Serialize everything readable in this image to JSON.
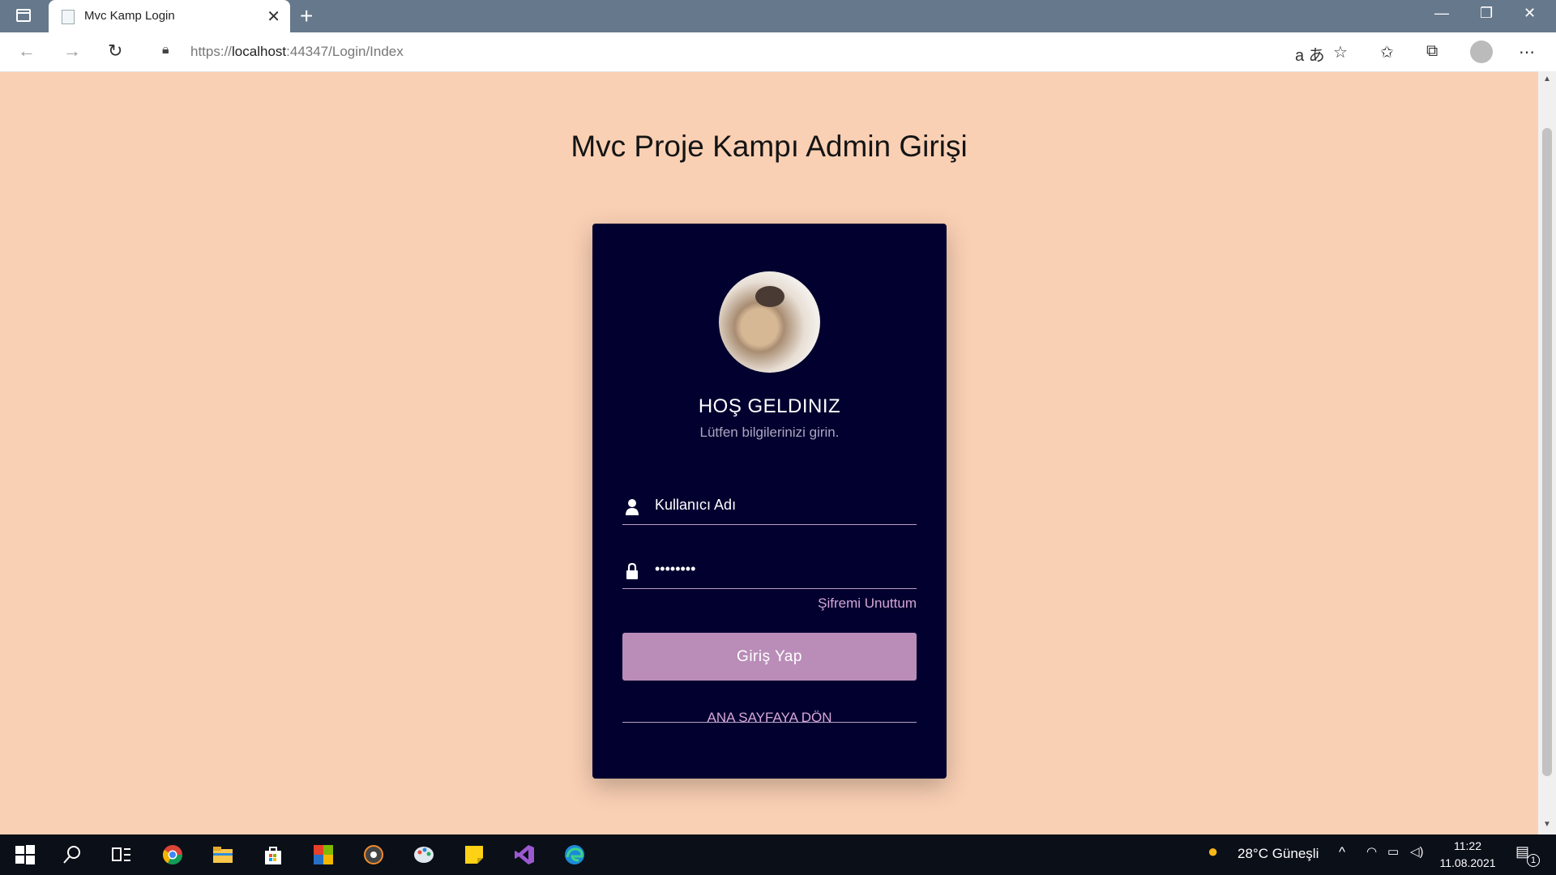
{
  "browser": {
    "tab_title": "Mvc Kamp Login",
    "url_prefix": "https://",
    "url_host": "localhost",
    "url_rest": ":44347/Login/Index"
  },
  "page": {
    "title": "Mvc Proje Kampı Admin Girişi",
    "welcome": "HOŞ GELDINIZ",
    "subtitle": "Lütfen bilgilerinizi girin.",
    "username_placeholder": "Kullanıcı Adı",
    "password_value": "********",
    "forgot_link": "Şifremi Unuttum",
    "login_button": "Giriş Yap",
    "home_link": "ANA SAYFAYA DÖN"
  },
  "taskbar": {
    "weather": "28°C  Güneşli",
    "time": "11:22",
    "date": "11.08.2021",
    "notification_count": "1"
  },
  "colors": {
    "page_bg": "#fad0b4",
    "card_bg": "#02002f",
    "button_bg": "#b98db8",
    "link": "#d6a6d6"
  }
}
